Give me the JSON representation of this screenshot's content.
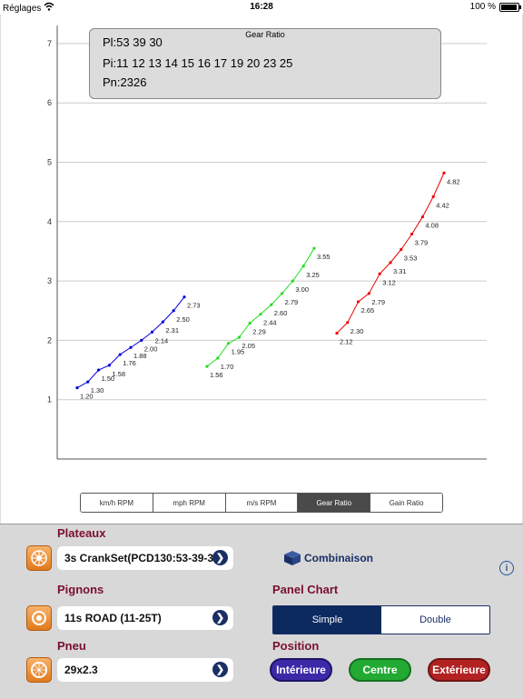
{
  "status_bar": {
    "carrier": "Réglages",
    "time": "16:28",
    "battery": "100 %",
    "battery_level": 1.0
  },
  "legend": {
    "title": "Gear Ratio",
    "line1": "Pl:53 39 30",
    "line2": "Pi:11 12 13 14 15 16 17 19 20 23 25",
    "line3": "Pn:2326"
  },
  "chart_data": {
    "type": "line",
    "title": "Gear Ratio",
    "yticks": [
      "1",
      "2",
      "3",
      "4",
      "5",
      "6",
      "7"
    ],
    "ylim": [
      0,
      7.3
    ],
    "x": [
      11,
      12,
      13,
      14,
      15,
      16,
      17,
      19,
      20,
      23,
      25
    ],
    "grid": true,
    "series": [
      {
        "color": "#0000dd",
        "values": [
          1.2,
          1.3,
          1.5,
          1.58,
          1.76,
          1.88,
          2.0,
          2.14,
          2.31,
          2.5,
          2.73
        ],
        "labels": [
          "1.20",
          "1.30",
          "1.50",
          "1.58",
          "1.76",
          "1.88",
          "2.00",
          "2.14",
          "2.31",
          "2.50",
          "2.73"
        ]
      },
      {
        "color": "#22dd22",
        "values": [
          1.56,
          1.7,
          1.95,
          2.05,
          2.29,
          2.44,
          2.6,
          2.79,
          3.0,
          3.25,
          3.55
        ],
        "labels": [
          "1.56",
          "1.70",
          "1.95",
          "2.05",
          "2.29",
          "2.44",
          "2.60",
          "2.79",
          "3.00",
          "3.25",
          "3.55"
        ]
      },
      {
        "color": "#ee0000",
        "values": [
          2.12,
          2.3,
          2.65,
          2.79,
          3.12,
          3.31,
          3.53,
          3.79,
          4.08,
          4.42,
          4.82
        ],
        "labels": [
          "2.12",
          "2.30",
          "2.65",
          "2.79",
          "3.12",
          "3.31",
          "3.53",
          "3.79",
          "4.08",
          "4.42",
          "4.82"
        ]
      }
    ]
  },
  "tabs": [
    {
      "label": "km/h RPM",
      "active": false
    },
    {
      "label": "mph RPM",
      "active": false
    },
    {
      "label": "m/s RPM",
      "active": false
    },
    {
      "label": "Gear Ratio",
      "active": true
    },
    {
      "label": "Gain Ratio",
      "active": false
    }
  ],
  "panel": {
    "plateaux_label": "Plateaux",
    "plateaux_value": "3s CrankSet(PCD130:53-39-30)",
    "pignons_label": "Pignons",
    "pignons_value": "11s ROAD (11-25T)",
    "pneu_label": "Pneu",
    "pneu_value": "29x2.3",
    "combinaison": "Combinaison",
    "panel_chart_label": "Panel Chart",
    "panel_chart_options": [
      "Simple",
      "Double"
    ],
    "panel_chart_selected": "Simple",
    "position_label": "Position",
    "position_buttons": [
      {
        "label": "Intérieure",
        "color": "#3b2aa8"
      },
      {
        "label": "Centre",
        "color": "#22aa33"
      },
      {
        "label": "Extérieure",
        "color": "#b32222"
      }
    ],
    "accent": "#7a0f2e",
    "navy": "#1b2f66"
  }
}
